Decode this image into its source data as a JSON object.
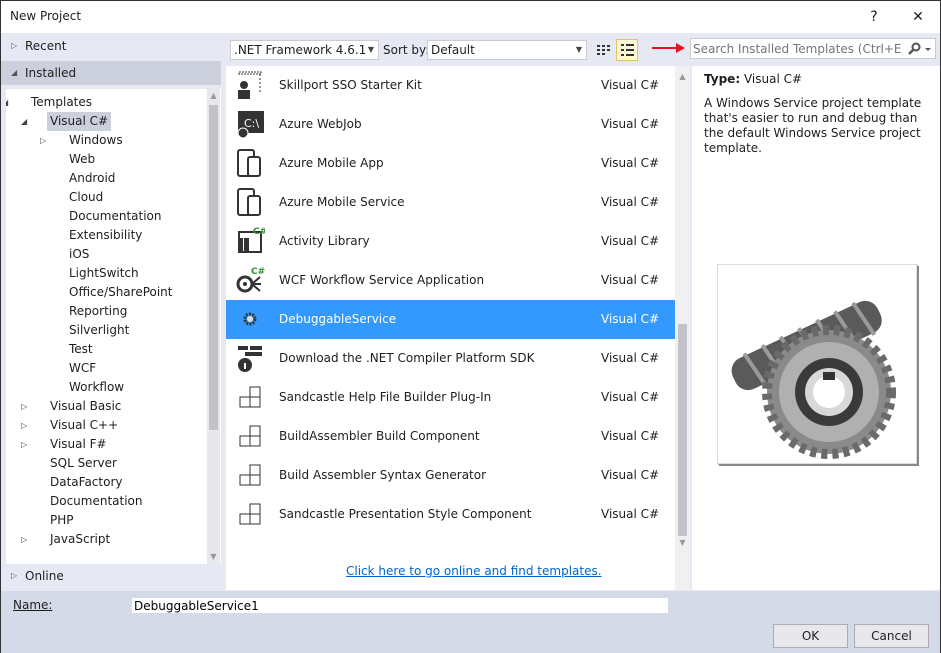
{
  "window": {
    "title": "New Project",
    "help_label": "?",
    "close_label": "✕"
  },
  "left": {
    "recent": "Recent",
    "installed": "Installed",
    "online": "Online",
    "tree": [
      {
        "label": "Templates",
        "level": 0,
        "expander": "open"
      },
      {
        "label": "Visual C#",
        "level": 1,
        "expander": "open",
        "selected": true
      },
      {
        "label": "Windows",
        "level": 2,
        "expander": "closed"
      },
      {
        "label": "Web",
        "level": 2
      },
      {
        "label": "Android",
        "level": 2
      },
      {
        "label": "Cloud",
        "level": 2
      },
      {
        "label": "Documentation",
        "level": 2
      },
      {
        "label": "Extensibility",
        "level": 2
      },
      {
        "label": "iOS",
        "level": 2
      },
      {
        "label": "LightSwitch",
        "level": 2
      },
      {
        "label": "Office/SharePoint",
        "level": 2
      },
      {
        "label": "Reporting",
        "level": 2
      },
      {
        "label": "Silverlight",
        "level": 2
      },
      {
        "label": "Test",
        "level": 2
      },
      {
        "label": "WCF",
        "level": 2
      },
      {
        "label": "Workflow",
        "level": 2
      },
      {
        "label": "Visual Basic",
        "level": 1,
        "expander": "closed"
      },
      {
        "label": "Visual C++",
        "level": 1,
        "expander": "closed"
      },
      {
        "label": "Visual F#",
        "level": 1,
        "expander": "closed"
      },
      {
        "label": "SQL Server",
        "level": 1
      },
      {
        "label": "DataFactory",
        "level": 1
      },
      {
        "label": "Documentation",
        "level": 1
      },
      {
        "label": "PHP",
        "level": 1
      },
      {
        "label": "JavaScript",
        "level": 1,
        "expander": "closed"
      }
    ]
  },
  "toolbar": {
    "framework": ".NET Framework 4.6.1",
    "sort_label": "Sort by:",
    "sort_value": "Default",
    "search_placeholder": "Search Installed Templates (Ctrl+E)",
    "active_view": "list"
  },
  "templates": [
    {
      "name": "Skillport SSO Starter Kit",
      "type": "Visual C#",
      "icon": "skillport-icon"
    },
    {
      "name": "Azure WebJob",
      "type": "Visual C#",
      "icon": "console-globe-icon"
    },
    {
      "name": "Azure Mobile App",
      "type": "Visual C#",
      "icon": "mobile-icon"
    },
    {
      "name": "Azure Mobile Service",
      "type": "Visual C#",
      "icon": "mobile-icon"
    },
    {
      "name": "Activity Library",
      "type": "Visual C#",
      "icon": "library-icon"
    },
    {
      "name": "WCF Workflow Service Application",
      "type": "Visual C#",
      "icon": "wcf-icon"
    },
    {
      "name": "DebuggableService",
      "type": "Visual C#",
      "icon": "gear-icon",
      "selected": true
    },
    {
      "name": "Download the .NET Compiler Platform SDK",
      "type": "Visual C#",
      "icon": "info-download-icon"
    },
    {
      "name": "Sandcastle Help File Builder Plug-In",
      "type": "Visual C#",
      "icon": "blocks-icon"
    },
    {
      "name": "BuildAssembler Build Component",
      "type": "Visual C#",
      "icon": "blocks-icon"
    },
    {
      "name": "Build Assembler Syntax Generator",
      "type": "Visual C#",
      "icon": "blocks-icon"
    },
    {
      "name": "Sandcastle Presentation Style Component",
      "type": "Visual C#",
      "icon": "blocks-icon"
    }
  ],
  "online_link": "Click here to go online and find templates.",
  "detail": {
    "type_label": "Type:",
    "type_value": "Visual C#",
    "description": "A Windows Service project template that's easier to run and debug than the default Windows Service project template."
  },
  "bottom": {
    "name_label": "Name:",
    "name_value": "DebuggableService1",
    "ok": "OK",
    "cancel": "Cancel"
  },
  "colors": {
    "selection": "#3399ff",
    "link": "#0066cc",
    "arrow": "#e81123"
  }
}
